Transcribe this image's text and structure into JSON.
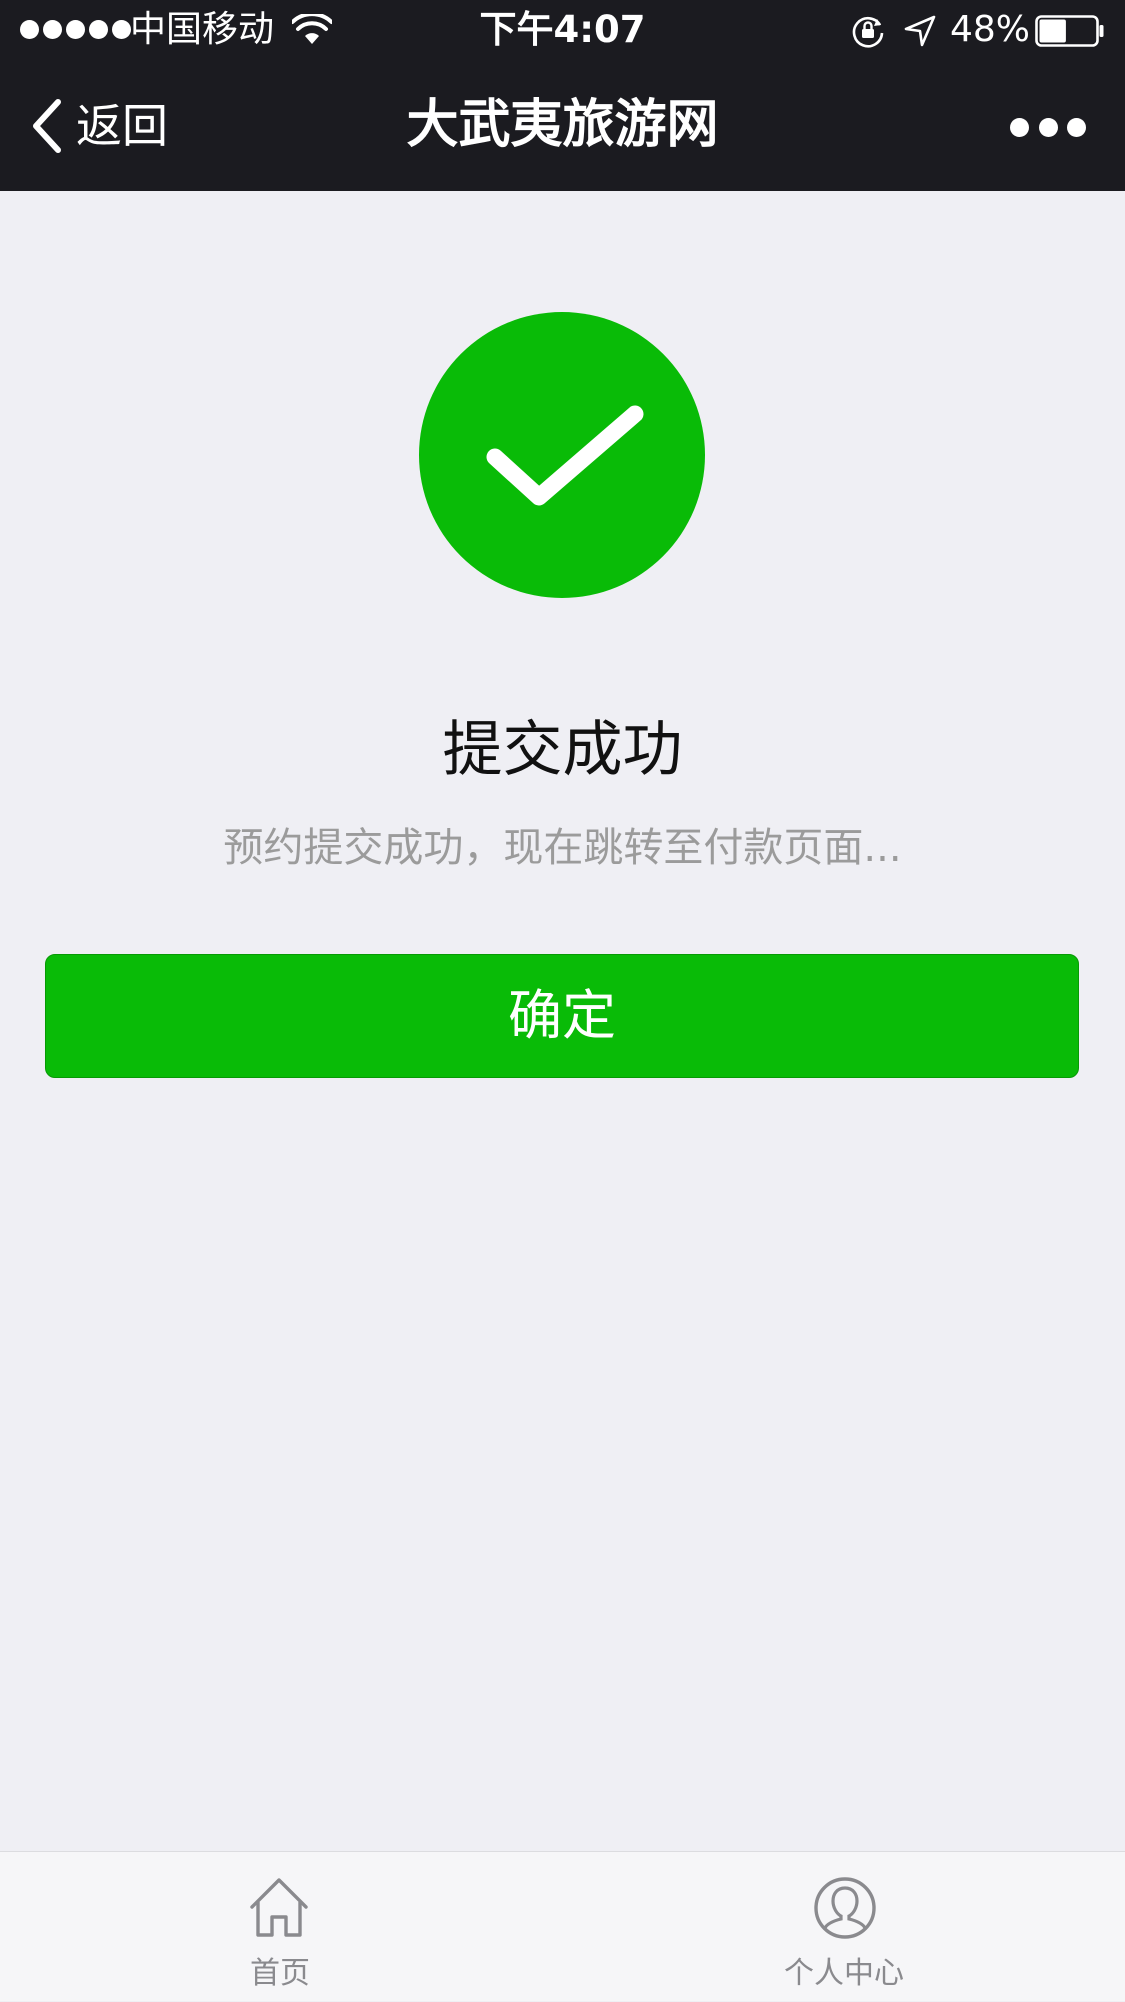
{
  "status_bar": {
    "carrier": "中国移动",
    "time": "下午4:07",
    "battery": "48%",
    "battery_level": 0.48,
    "icons": [
      "signal-dots",
      "wifi-icon",
      "orientation-lock-icon",
      "location-icon",
      "battery-icon"
    ]
  },
  "nav": {
    "back_label": "返回",
    "title": "大武夷旅游网",
    "more_icon": "more-dots-icon"
  },
  "result": {
    "icon": "success-check-icon",
    "title": "提交成功",
    "message": "预约提交成功，现在跳转至付款页面..."
  },
  "confirm_button": {
    "label": "确定"
  },
  "tab_bar": {
    "items": [
      {
        "label": "首页",
        "icon": "home-icon"
      },
      {
        "label": "个人中心",
        "icon": "user-icon"
      }
    ]
  },
  "colors": {
    "accent": "#09bb07",
    "nav_background": "#1b1b20",
    "page_background": "#efeff4",
    "secondary_text": "#9b9b9b"
  }
}
